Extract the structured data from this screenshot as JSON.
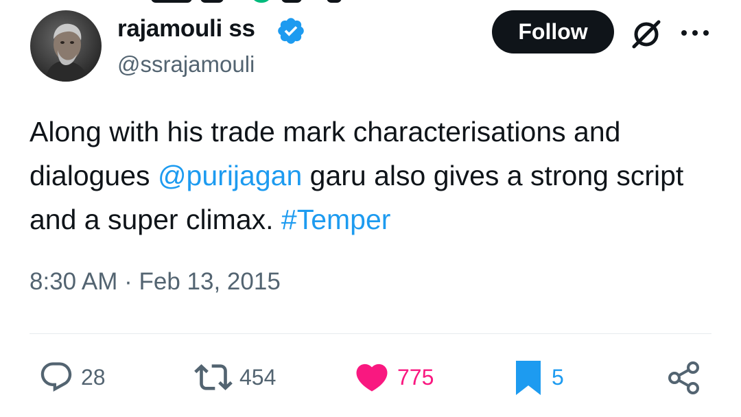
{
  "author": {
    "display_name": "rajamouli ss",
    "handle": "@ssrajamouli",
    "verified": true,
    "avatar": "profile-photo"
  },
  "follow_button": {
    "label": "Follow"
  },
  "header_icons": [
    "grok-icon",
    "more-options-icon"
  ],
  "tweet": {
    "text_part_1": "Along with his trade mark characterisations and dialogues ",
    "mention": "@purijagan",
    "text_part_2": " garu also gives a strong script and a super climax. ",
    "hashtag": "#Temper",
    "timestamp": "8:30 AM · Feb 13, 2015"
  },
  "actions": {
    "replies": "28",
    "reposts": "454",
    "likes": "775",
    "bookmarks": "5"
  },
  "colors": {
    "text": "#0f1419",
    "secondary": "#536471",
    "link": "#1d9bf0",
    "like": "#f91880",
    "verified": "#1d9bf0",
    "button_bg": "#0f1419"
  }
}
